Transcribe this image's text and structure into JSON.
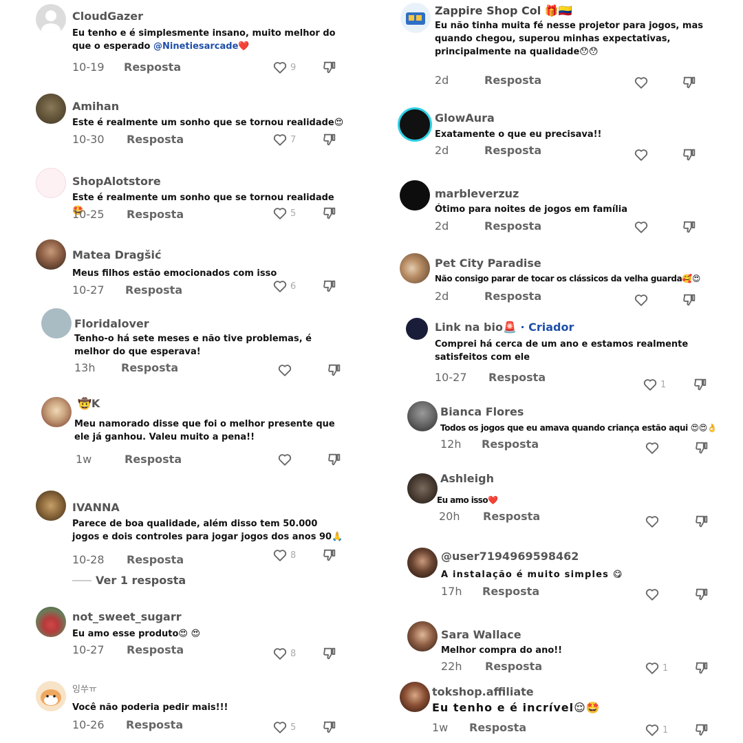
{
  "reply_label": "Resposta",
  "left": [
    {
      "name": "CloudGazer",
      "text": "Eu tenho e é simplesmente insano, muito melhor do que o esperado ",
      "mention": "@Ninetiesarcade",
      "suffix": "❤️",
      "date": "10-19",
      "likes": "9"
    },
    {
      "name": "Amihan",
      "text": "Este é realmente um sonho que se tornou realidade😍",
      "date": "10-30",
      "likes": "7"
    },
    {
      "name": "ShopAlotstore",
      "text": "Este é realmente um sonho que se tornou realidade 🤩",
      "date": "10-25",
      "likes": "5"
    },
    {
      "name": "Matea Dragšić",
      "text": "Meus filhos estão emocionados com isso",
      "date": "10-27",
      "likes": "6"
    },
    {
      "name": "Floridalover",
      "text": "Tenho-o há sete meses e não tive problemas, é melhor do que esperava!",
      "date": "13h",
      "likes": ""
    },
    {
      "name": "🤠K",
      "text": "Meu namorado disse que foi o melhor presente que ele já ganhou. Valeu muito a pena!!",
      "date": "1w",
      "likes": ""
    },
    {
      "name": "IVANNA",
      "text": "Parece de boa qualidade, além disso tem 50.000 jogos e dois controles para jogar jogos dos anos 90🙏",
      "date": "10-28",
      "likes": "8",
      "view_replies": "Ver 1 resposta"
    },
    {
      "name": "not_sweet_sugarr",
      "text": "Eu amo esse produto😍 😍",
      "date": "10-27",
      "likes": "8"
    },
    {
      "name": "잉쑤ㅠ",
      "text": "Você não poderia pedir mais!!!",
      "date": "10-26",
      "likes": "5"
    }
  ],
  "right": [
    {
      "name": "Zappire Shop Col 🎁🇨🇴",
      "text": "Eu não tinha muita fé nesse projetor para jogos, mas quando chegou, superou minhas expectativas, principalmente na qualidade😯😯",
      "date": "2d",
      "likes": ""
    },
    {
      "name": "GlowAura",
      "text": "Exatamente o que eu precisava!!",
      "date": "2d",
      "likes": ""
    },
    {
      "name": "marbleverzuz",
      "text": "Ótimo para noites de jogos em família",
      "date": "2d",
      "likes": ""
    },
    {
      "name": "Pet City Paradise",
      "text": "Não consigo parar de tocar os clássicos da velha guarda🥰😍",
      "date": "2d",
      "likes": ""
    },
    {
      "name": "Link na bio🚨",
      "badge": "· Criador",
      "text": "Comprei há cerca de um ano e estamos realmente satisfeitos com ele",
      "date": "10-27",
      "likes": "1"
    },
    {
      "name": "Bianca Flores",
      "text": "Todos os jogos que eu amava quando criança estão aqui 😍😍👌",
      "date": "12h",
      "likes": ""
    },
    {
      "name": "Ashleigh",
      "text": "Eu amo isso❤️",
      "date": "20h",
      "likes": ""
    },
    {
      "name": "@user7194969598462",
      "text": "A instalação é muito simples 😋",
      "date": "17h",
      "likes": ""
    },
    {
      "name": "Sara Wallace",
      "text": "Melhor compra do ano!!",
      "date": "22h",
      "likes": "1"
    },
    {
      "name": "tokshop.affiliate",
      "text": "Eu tenho e é incrível😌🤩",
      "date": "1w",
      "likes": "1"
    }
  ],
  "colors": {
    "mention": "#1f4fa8",
    "badge": "#1f4fa8",
    "name": "#555555",
    "meta": "#666666"
  }
}
